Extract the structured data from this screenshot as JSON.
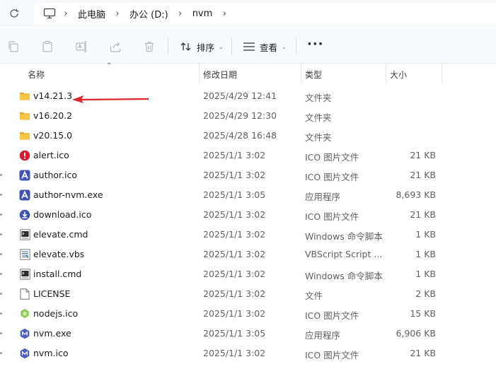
{
  "address": {
    "breadcrumbs": [
      "此电脑",
      "办公 (D:)",
      "nvm"
    ]
  },
  "toolbar": {
    "icons": [
      "copy-icon",
      "paste-icon",
      "rename-icon",
      "share-icon",
      "delete-icon"
    ],
    "sort_label": "排序",
    "view_label": "查看",
    "more_label": "···"
  },
  "columns": {
    "name": "名称",
    "date": "修改日期",
    "type": "类型",
    "size": "大小"
  },
  "files": [
    {
      "name": "v14.21.3",
      "date": "2025/4/29 12:41",
      "type": "文件夹",
      "size": "",
      "icon": "folder-icon"
    },
    {
      "name": "v16.20.2",
      "date": "2025/4/29 12:30",
      "type": "文件夹",
      "size": "",
      "icon": "folder-icon"
    },
    {
      "name": "v20.15.0",
      "date": "2025/4/28 16:48",
      "type": "文件夹",
      "size": "",
      "icon": "folder-icon"
    },
    {
      "name": "alert.ico",
      "date": "2025/1/1 3:02",
      "type": "ICO 图片文件",
      "size": "21 KB",
      "icon": "alert-icon"
    },
    {
      "name": "author.ico",
      "date": "2025/1/1 3:02",
      "type": "ICO 图片文件",
      "size": "21 KB",
      "icon": "author-icon"
    },
    {
      "name": "author-nvm.exe",
      "date": "2025/1/1 3:05",
      "type": "应用程序",
      "size": "8,693 KB",
      "icon": "author-icon"
    },
    {
      "name": "download.ico",
      "date": "2025/1/1 3:02",
      "type": "ICO 图片文件",
      "size": "21 KB",
      "icon": "download-icon"
    },
    {
      "name": "elevate.cmd",
      "date": "2025/1/1 3:02",
      "type": "Windows 命令脚本",
      "size": "1 KB",
      "icon": "cmd-script-icon"
    },
    {
      "name": "elevate.vbs",
      "date": "2025/1/1 3:02",
      "type": "VBScript Script ...",
      "size": "1 KB",
      "icon": "vbs-script-icon"
    },
    {
      "name": "install.cmd",
      "date": "2025/1/1 3:02",
      "type": "Windows 命令脚本",
      "size": "1 KB",
      "icon": "cmd-script-icon"
    },
    {
      "name": "LICENSE",
      "date": "2025/1/1 3:02",
      "type": "文件",
      "size": "2 KB",
      "icon": "blank-file-icon"
    },
    {
      "name": "nodejs.ico",
      "date": "2025/1/1 3:02",
      "type": "ICO 图片文件",
      "size": "15 KB",
      "icon": "nodejs-icon"
    },
    {
      "name": "nvm.exe",
      "date": "2025/1/1 3:05",
      "type": "应用程序",
      "size": "6,906 KB",
      "icon": "nvm-icon"
    },
    {
      "name": "nvm.ico",
      "date": "2025/1/1 3:02",
      "type": "ICO 图片文件",
      "size": "21 KB",
      "icon": "nvm-icon"
    }
  ],
  "colors": {
    "folder": "#f4c542",
    "accent_blue": "#3f51b5",
    "alert_red": "#d81b2a",
    "arrow_red": "#e0262b",
    "nodejs_green": "#8cc84b"
  }
}
